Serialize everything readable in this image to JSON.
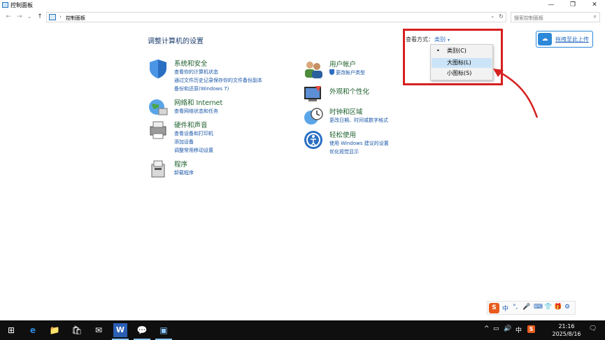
{
  "window": {
    "title": "控制面板",
    "minimize_glyph": "—",
    "restore_glyph": "❐",
    "close_glyph": "✕"
  },
  "addressbar": {
    "back_glyph": "←",
    "forward_glyph": "→",
    "recent_glyph": "⌄",
    "up_glyph": "↑",
    "separator": "›",
    "breadcrumb": "控制面板",
    "dropdown_glyph": "⌄",
    "refresh_glyph": "↻",
    "search_placeholder": "搜索控制面板",
    "search_glyph": "⌕"
  },
  "content": {
    "heading": "调整计算机的设置",
    "view_by_label": "查看方式：",
    "view_by_value": "类别",
    "view_by_caret": "▾",
    "dropdown": {
      "bullet": "•",
      "options": [
        "类别(C)",
        "大图标(L)",
        "小图标(S)"
      ],
      "highlighted_index": 1
    },
    "cloud_button": "拖拽至此上传",
    "cloud_icon": "☁",
    "categories": [
      {
        "title": "系统和安全",
        "links": [
          "查看你的计算机状态",
          "通过文件历史记录保存你的文件备份副本",
          "备份和还原(Windows 7)"
        ]
      },
      {
        "title": "网络和 Internet",
        "links": [
          "查看网络状态和任务"
        ]
      },
      {
        "title": "硬件和声音",
        "links": [
          "查看设备和打印机",
          "添加设备",
          "调整常用移动设置"
        ]
      },
      {
        "title": "程序",
        "links": [
          "卸载程序"
        ]
      },
      {
        "title": "用户帐户",
        "links": [
          "更改帐户类型"
        ]
      },
      {
        "title": "外观和个性化",
        "links": []
      },
      {
        "title": "时钟和区域",
        "links": [
          "更改日期、时间或数字格式"
        ]
      },
      {
        "title": "轻松使用",
        "links": [
          "使用 Windows 建议的设置",
          "优化视觉显示"
        ]
      }
    ]
  },
  "ime": {
    "logo": "S",
    "glyphs": [
      "中",
      "°,",
      "🎤",
      "⌨",
      "👕",
      "🎁",
      "⚙"
    ]
  },
  "taskbar": {
    "start_glyph": "⊞",
    "apps": [
      "e",
      "📁",
      "🛍",
      "✉",
      "W",
      "💬",
      "▣"
    ],
    "tray": [
      "^",
      "▭",
      "🔊",
      "中",
      "S"
    ],
    "time": "21:16",
    "date": "2025/8/16",
    "notification_glyph": "🗨",
    "colors": {
      "edge": "#2d8ae0",
      "word": "#2b5fb4",
      "wechat": "#2dc14a",
      "sogou": "#e85c1e"
    }
  }
}
